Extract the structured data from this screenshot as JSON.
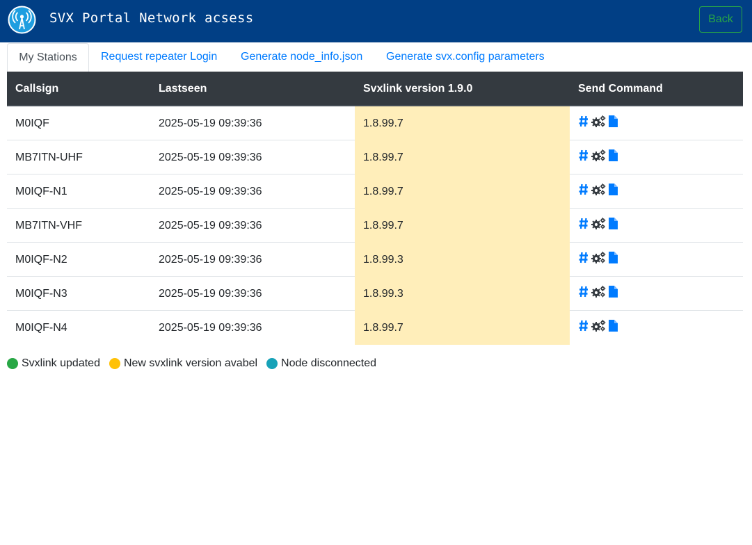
{
  "header": {
    "title": "SVX Portal Network acsess",
    "back_label": "Back"
  },
  "tabs": [
    {
      "label": "My Stations",
      "active": true
    },
    {
      "label": "Request repeater Login",
      "active": false
    },
    {
      "label": "Generate node_info.json",
      "active": false
    },
    {
      "label": "Generate svx.config parameters",
      "active": false
    }
  ],
  "table": {
    "headers": [
      "Callsign",
      "Lastseen",
      "Svxlink version 1.9.0",
      "Send Command"
    ],
    "rows": [
      {
        "callsign": "M0IQF",
        "lastseen": "2025-05-19 09:39:36",
        "version": "1.8.99.7"
      },
      {
        "callsign": "MB7ITN-UHF",
        "lastseen": "2025-05-19 09:39:36",
        "version": "1.8.99.7"
      },
      {
        "callsign": "M0IQF-N1",
        "lastseen": "2025-05-19 09:39:36",
        "version": "1.8.99.7"
      },
      {
        "callsign": "MB7ITN-VHF",
        "lastseen": "2025-05-19 09:39:36",
        "version": "1.8.99.7"
      },
      {
        "callsign": "M0IQF-N2",
        "lastseen": "2025-05-19 09:39:36",
        "version": "1.8.99.3"
      },
      {
        "callsign": "M0IQF-N3",
        "lastseen": "2025-05-19 09:39:36",
        "version": "1.8.99.3"
      },
      {
        "callsign": "M0IQF-N4",
        "lastseen": "2025-05-19 09:39:36",
        "version": "1.8.99.7"
      }
    ],
    "command_icons": [
      "hash-icon",
      "gears-icon",
      "file-icon"
    ]
  },
  "legend": [
    {
      "label": "Svxlink updated",
      "color": "#28a745"
    },
    {
      "label": "New svxlink version avabel",
      "color": "#ffc107"
    },
    {
      "label": "Node disconnected",
      "color": "#17a2b8"
    }
  ],
  "colors": {
    "navbar": "#013f85",
    "accent": "#007bff",
    "outdated_version_bg": "#ffeeba",
    "table_header": "#343a40"
  }
}
